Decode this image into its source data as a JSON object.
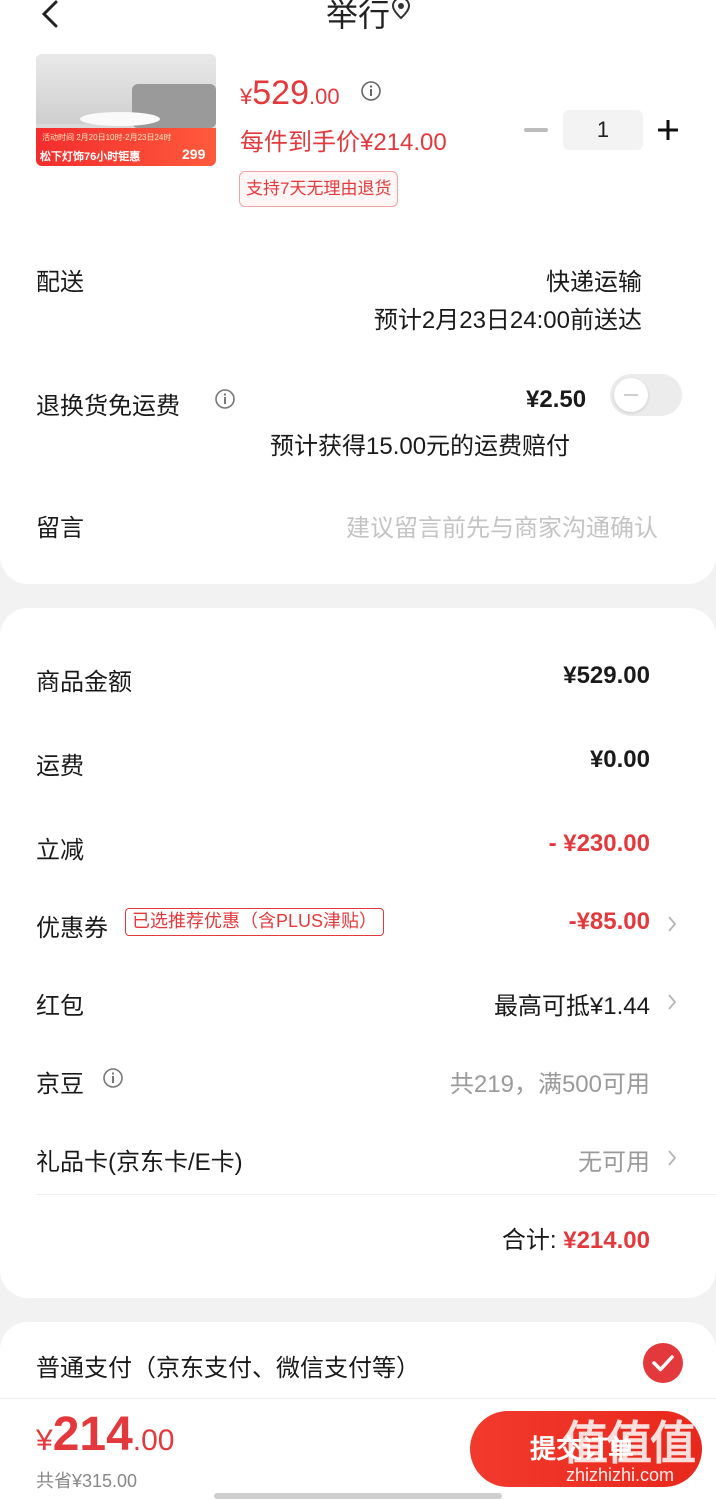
{
  "header": {
    "title": "举行"
  },
  "product": {
    "thumb_band_line": "活动时间 2月20日10时-2月23日24时",
    "thumb_band_main": "松下灯饰76小时钜惠",
    "thumb_band_num": "299",
    "price_yen": "¥",
    "price_int": "529",
    "price_dec": ".00",
    "quantity": "1",
    "unit_price": "每件到手价¥214.00",
    "return_badge": "支持7天无理由退货"
  },
  "shipping": {
    "label": "配送",
    "method": "快递运输",
    "eta": "预计2月23日24:00前送达"
  },
  "return_insurance": {
    "label": "退换货免运费",
    "price": "¥2.50",
    "note": "预计获得15.00元的运费赔付",
    "enabled": false
  },
  "message": {
    "label": "留言",
    "placeholder": "建议留言前先与商家沟通确认"
  },
  "summary": {
    "goods_label": "商品金额",
    "goods_value": "¥529.00",
    "freight_label": "运费",
    "freight_value": "¥0.00",
    "discount_label": "立减",
    "discount_value": "- ¥230.00",
    "coupon_label": "优惠券",
    "coupon_tag": "已选推荐优惠（含PLUS津贴）",
    "coupon_value": "-¥85.00",
    "redpacket_label": "红包",
    "redpacket_value": "最高可抵¥1.44",
    "jingdou_label": "京豆",
    "jingdou_value": "共219，满500可用",
    "giftcard_label": "礼品卡(京东卡/E卡)",
    "giftcard_value": "无可用",
    "total_label": "合计:",
    "total_value": "¥214.00"
  },
  "payment": {
    "method_label": "普通支付（京东支付、微信支付等）",
    "selected": true
  },
  "bottom_bar": {
    "yen": "¥",
    "total_int": "214",
    "total_dec": ".00",
    "saved": "共省¥315.00",
    "submit_label": "提交订单"
  },
  "watermark": {
    "logo": "值值值",
    "url": "zhizhizhi.com"
  },
  "colors": {
    "accent": "#e4393c",
    "background": "#f2f2f2",
    "card": "#ffffff"
  }
}
